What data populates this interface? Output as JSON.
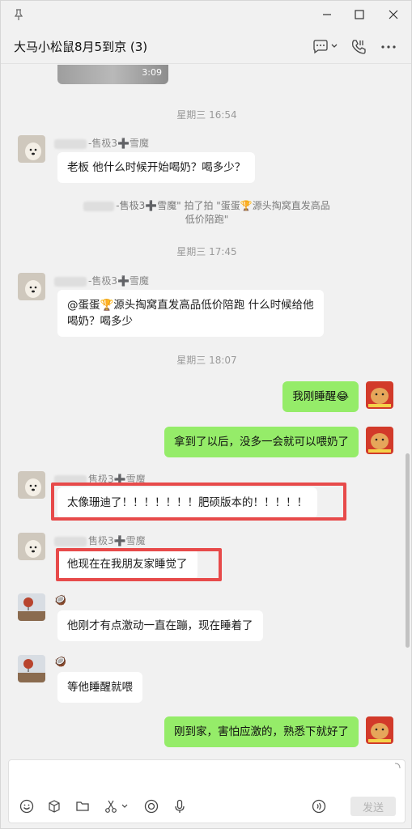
{
  "window": {
    "title": "大马小松鼠8月5到京 (3)"
  },
  "chat": {
    "video_duration": "3:09",
    "timestamps": [
      "星期三 16:54",
      "星期三 17:45",
      "星期三 18:07"
    ],
    "messages": [
      {
        "sender": "-售极3➕雪魔",
        "text": "老板 他什么时候开始喝奶？喝多少？"
      },
      {
        "system_line1": "-售极3➕雪魔\" 拍了拍 \"蛋蛋🏆源头掏窝直发高品",
        "system_line2": "低价陪跑\""
      },
      {
        "sender": "-售极3➕雪魔",
        "text_line1": "@蛋蛋🏆源头掏窝直发高品低价陪跑 什么时候给他",
        "text_line2": "喝奶？喝多少"
      },
      {
        "text": "我刚睡醒😂"
      },
      {
        "text": "拿到了以后，没多一会就可以喂奶了"
      },
      {
        "sender": "售极3➕雪魔",
        "text": "太像珊迪了！！！！！！！肥硕版本的！！！！！"
      },
      {
        "sender": "售极3➕雪魔",
        "text": "他现在在我朋友家睡觉了"
      },
      {
        "sender": "🥥",
        "text": "他刚才有点激动一直在蹦，现在睡着了"
      },
      {
        "sender": "🥥",
        "text": "等他睡醒就喂"
      },
      {
        "text": "刚到家，害怕应激的，熟悉下就好了"
      }
    ]
  },
  "composer": {
    "send_label": "发送"
  },
  "colors": {
    "bubble_self": "#95ec69",
    "highlight": "#e74a4a"
  }
}
